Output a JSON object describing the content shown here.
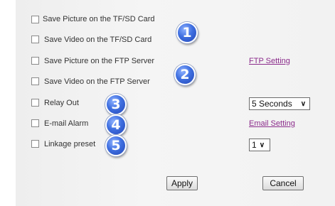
{
  "options": [
    {
      "label": "Save Picture on the TF/SD Card"
    },
    {
      "label": "Save Video on the TF/SD Card"
    },
    {
      "label": "Save Picture on the FTP Server"
    },
    {
      "label": "Save Video on the FTP Server"
    },
    {
      "label": "Relay Out"
    },
    {
      "label": "E-mail Alarm"
    },
    {
      "label": "Linkage preset"
    }
  ],
  "links": {
    "ftp_setting": "FTP Setting",
    "email_setting": "Email Setting"
  },
  "relay_duration": {
    "selected": "5 Seconds"
  },
  "linkage_preset": {
    "selected": "1"
  },
  "badges": [
    "1",
    "2",
    "3",
    "4",
    "5"
  ],
  "buttons": {
    "apply": "Apply",
    "cancel": "Cancel"
  }
}
